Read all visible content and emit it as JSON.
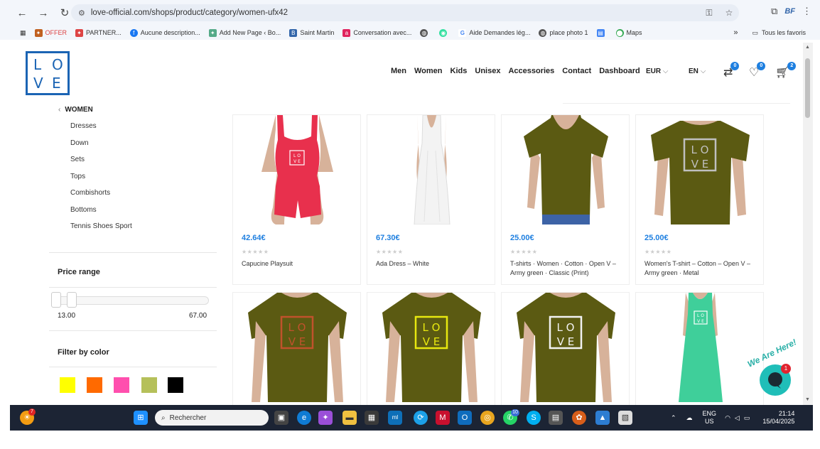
{
  "browser": {
    "url": "love-official.com/shops/product/category/women-ufx42",
    "bookmarks": [
      "OFFER",
      "PARTNER...",
      "Aucune description...",
      "Add New Page ‹ Bo...",
      "Saint Martin",
      "Conversation avec...",
      "Aide Demandes lég...",
      "place photo 1",
      "Maps"
    ],
    "all_favorites": "Tous les favoris",
    "ext_label": "BF"
  },
  "header": {
    "logo_letters": [
      "L",
      "O",
      "V",
      "E"
    ],
    "nav": [
      "Men",
      "Women",
      "Kids",
      "Unisex",
      "Accessories",
      "Contact",
      "Dashboard"
    ],
    "currency": "EUR",
    "language": "EN",
    "compare_count": "0",
    "wishlist_count": "0",
    "cart_count": "2"
  },
  "sidebar": {
    "category": "WOMEN",
    "subcategories": [
      "Dresses",
      "Down",
      "Sets",
      "Tops",
      "Combishorts",
      "Bottoms",
      "Tennis Shoes Sport"
    ],
    "price_title": "Price range",
    "price_min": "13.00",
    "price_max": "67.00",
    "color_title": "Filter by color",
    "colors": [
      "#ffff00",
      "#ff6a00",
      "#ff4fae",
      "#b5c05a",
      "#000000"
    ]
  },
  "products": [
    {
      "price": "42.64€",
      "name": "Capucine Playsuit",
      "stars": "★★★★★"
    },
    {
      "price": "67.30€",
      "name": "Ada Dress – White",
      "stars": "★★★★★"
    },
    {
      "price": "25.00€",
      "name": "T-shirts · Women · Cotton · Open V – Army green · Classic (Print)",
      "stars": "★★★★★"
    },
    {
      "price": "25.00€",
      "name": "Women's T-shirt – Cotton – Open V – Army green · Metal",
      "stars": "★★★★★"
    },
    {
      "price": "",
      "name": "",
      "stars": ""
    },
    {
      "price": "",
      "name": "",
      "stars": ""
    },
    {
      "price": "",
      "name": "",
      "stars": ""
    },
    {
      "price": "",
      "name": "",
      "stars": ""
    }
  ],
  "chat": {
    "label": "We Are Here!",
    "badge": "1"
  },
  "taskbar": {
    "search_placeholder": "Rechercher",
    "weather_badge": "7",
    "whatsapp_badge": "10",
    "lang_top": "ENG",
    "lang_bottom": "US",
    "time": "21:14",
    "date": "15/04/2025"
  }
}
